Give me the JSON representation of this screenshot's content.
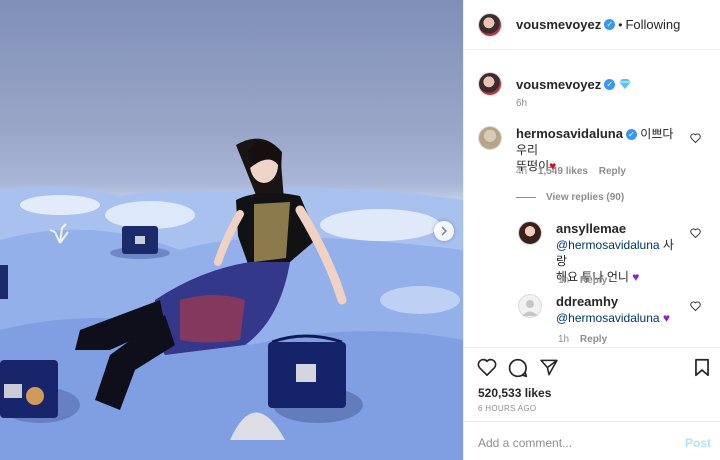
{
  "header": {
    "username": "vousmevoyez",
    "separator": "•",
    "follow_status": "Following"
  },
  "caption": {
    "username": "vousmevoyez",
    "time": "6h"
  },
  "comments": [
    {
      "username": "hermosavidaluna",
      "text": "이쁘다 우리",
      "text_line2": "뚜떵이",
      "time": "4h",
      "likes": "1,549 likes",
      "reply": "Reply",
      "view_replies": "View replies (90)"
    }
  ],
  "replies": [
    {
      "username": "ansyllemae",
      "mention": "@hermosavidaluna",
      "text": "사랑",
      "text_line2": "해요 투나 언니",
      "time": "1h",
      "reply": "Reply"
    },
    {
      "username": "ddreamhy",
      "mention": "@hermosavidaluna",
      "time": "1h",
      "reply": "Reply"
    }
  ],
  "post": {
    "likes": "520,533 likes",
    "time_ago": "6 HOURS AGO"
  },
  "add_comment": {
    "placeholder": "Add a comment...",
    "post_label": "Post"
  },
  "colors": {
    "verified": "#3897f0",
    "mention": "#003569",
    "heart": "#c0182a",
    "purple_heart": "#8c1fd6",
    "post_disabled": "#b2dffc"
  },
  "icons": [
    "heart-icon",
    "comment-icon",
    "share-icon",
    "bookmark-icon",
    "verified-icon",
    "chevron-right-icon"
  ]
}
